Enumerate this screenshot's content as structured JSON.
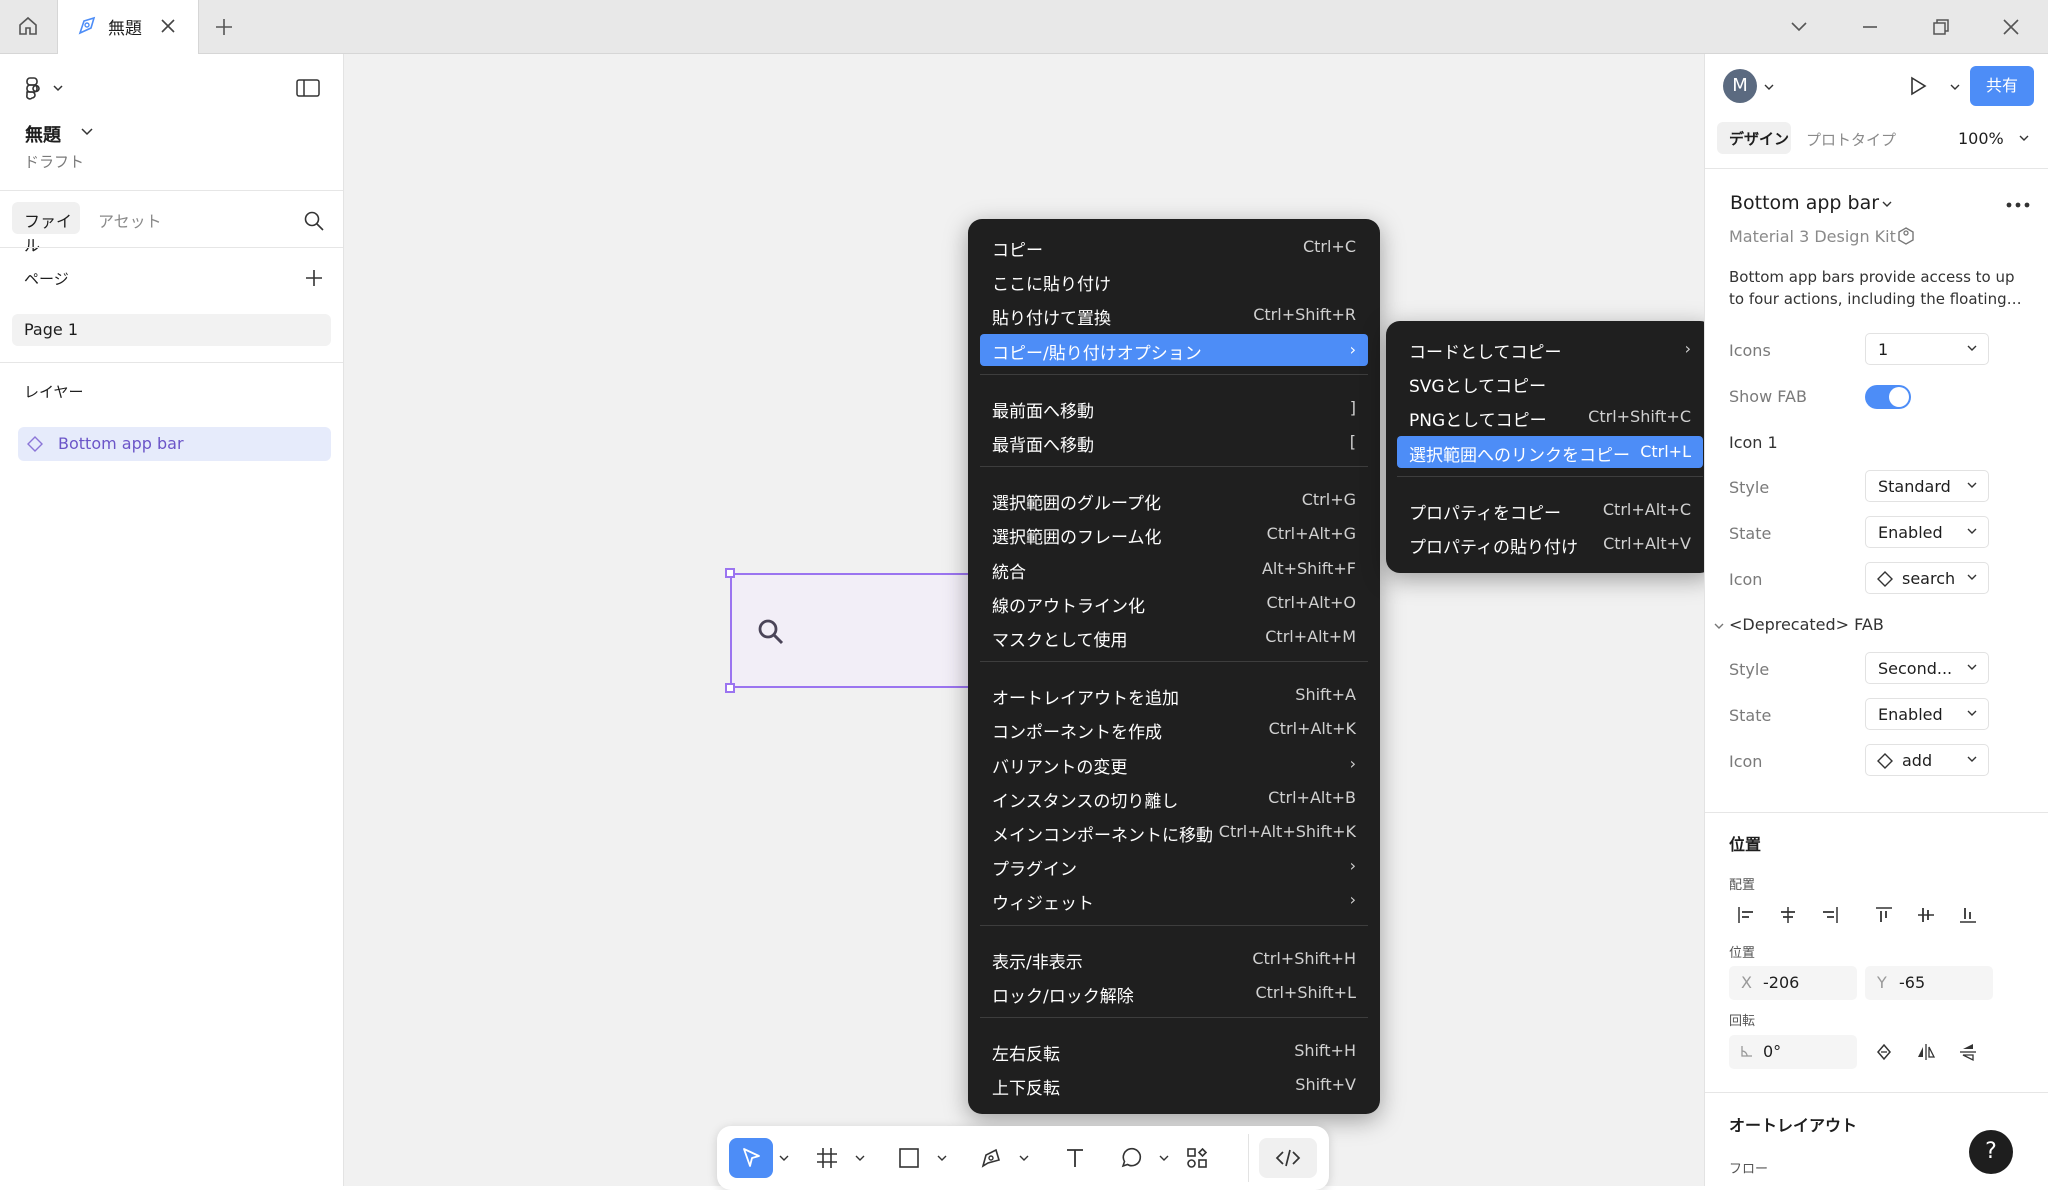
{
  "titlebar": {
    "tab_title": "無題"
  },
  "left_panel": {
    "file_name": "無題",
    "file_sub": "ドラフト",
    "tabs": [
      {
        "label": "ファイル"
      },
      {
        "label": "アセット"
      }
    ],
    "pages_title": "ページ",
    "pages": [
      {
        "label": "Page 1"
      }
    ],
    "layers_title": "レイヤー",
    "layers": [
      {
        "label": "Bottom app bar"
      }
    ]
  },
  "right_panel": {
    "avatar_initial": "M",
    "share_label": "共有",
    "tabs": [
      {
        "label": "デザイン"
      },
      {
        "label": "プロトタイプ"
      }
    ],
    "zoom": "100%",
    "component_title": "Bottom app bar",
    "library": "Material 3 Design Kit",
    "description": "Bottom app bars provide access to up to four actions, including the floating…",
    "props": {
      "icons_label": "Icons",
      "icons_value": "1",
      "show_fab_label": "Show FAB",
      "icon1_title": "Icon 1",
      "style_label": "Style",
      "style_value": "Standard",
      "state_label": "State",
      "state_value": "Enabled",
      "icon_label": "Icon",
      "icon_value": "search",
      "fab_title": "<Deprecated> FAB",
      "fab_style_label": "Style",
      "fab_style_value": "Second...",
      "fab_state_label": "State",
      "fab_state_value": "Enabled",
      "fab_icon_label": "Icon",
      "fab_icon_value": "add"
    },
    "position": {
      "title": "位置",
      "align_label": "配置",
      "pos_label": "位置",
      "x_label": "X",
      "x_value": "-206",
      "y_label": "Y",
      "y_value": "-65",
      "rotation_label": "回転",
      "rotation_value": "0°"
    },
    "autolayout": {
      "title": "オートレイアウト",
      "flow_label": "フロー"
    },
    "help": "?"
  },
  "context_menu": {
    "groups": [
      [
        {
          "label": "コピー",
          "shortcut": "Ctrl+C"
        },
        {
          "label": "ここに貼り付け",
          "shortcut": ""
        },
        {
          "label": "貼り付けて置換",
          "shortcut": "Ctrl+Shift+R"
        },
        {
          "label": "コピー/貼り付けオプション",
          "shortcut": "›"
        }
      ],
      [
        {
          "label": "最前面へ移動",
          "shortcut": "]"
        },
        {
          "label": "最背面へ移動",
          "shortcut": "["
        }
      ],
      [
        {
          "label": "選択範囲のグループ化",
          "shortcut": "Ctrl+G"
        },
        {
          "label": "選択範囲のフレーム化",
          "shortcut": "Ctrl+Alt+G"
        },
        {
          "label": "統合",
          "shortcut": "Alt+Shift+F"
        },
        {
          "label": "線のアウトライン化",
          "shortcut": "Ctrl+Alt+O"
        },
        {
          "label": "マスクとして使用",
          "shortcut": "Ctrl+Alt+M"
        }
      ],
      [
        {
          "label": "オートレイアウトを追加",
          "shortcut": "Shift+A"
        },
        {
          "label": "コンポーネントを作成",
          "shortcut": "Ctrl+Alt+K"
        },
        {
          "label": "バリアントの変更",
          "shortcut": "›"
        },
        {
          "label": "インスタンスの切り離し",
          "shortcut": "Ctrl+Alt+B"
        },
        {
          "label": "メインコンポーネントに移動",
          "shortcut": "Ctrl+Alt+Shift+K"
        },
        {
          "label": "プラグイン",
          "shortcut": "›"
        },
        {
          "label": "ウィジェット",
          "shortcut": "›"
        }
      ],
      [
        {
          "label": "表示/非表示",
          "shortcut": "Ctrl+Shift+H"
        },
        {
          "label": "ロック/ロック解除",
          "shortcut": "Ctrl+Shift+L"
        }
      ],
      [
        {
          "label": "左右反転",
          "shortcut": "Shift+H"
        },
        {
          "label": "上下反転",
          "shortcut": "Shift+V"
        }
      ]
    ]
  },
  "submenu": {
    "groups": [
      [
        {
          "label": "コードとしてコピー",
          "shortcut": "›"
        },
        {
          "label": "SVGとしてコピー",
          "shortcut": ""
        },
        {
          "label": "PNGとしてコピー",
          "shortcut": "Ctrl+Shift+C"
        },
        {
          "label": "選択範囲へのリンクをコピー",
          "shortcut": "Ctrl+L"
        }
      ],
      [
        {
          "label": "プロパティをコピー",
          "shortcut": "Ctrl+Alt+C"
        },
        {
          "label": "プロパティの貼り付け",
          "shortcut": "Ctrl+Alt+V"
        }
      ]
    ]
  },
  "colors": {
    "accent": "#4d8df7",
    "menu_bg": "#1f1f1f",
    "selection": "#9b74f0",
    "toolbar_active": "#4d8df7"
  }
}
